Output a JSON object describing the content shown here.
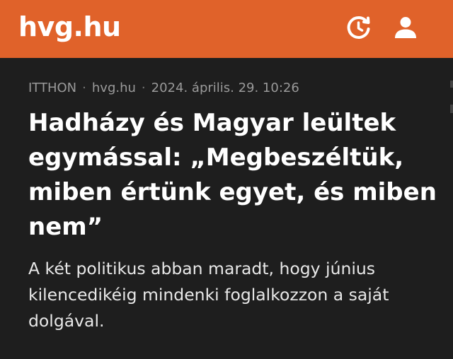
{
  "header": {
    "logo": "hvg.hu",
    "history_icon": "clock-history-icon",
    "user_icon": "user-icon",
    "background": "#e0622a"
  },
  "article": {
    "category": "ITTHON",
    "source": "hvg.hu",
    "date": "2024. április. 29. 10:26",
    "headline": "Hadházy és Magyar leültek egymással: „Megbeszéltük, miben értünk egyet, és miben nem”",
    "lead": "A két politikus abban maradt, hogy június kilencedikéig mindenki foglalkozzon a saját dolgával."
  }
}
